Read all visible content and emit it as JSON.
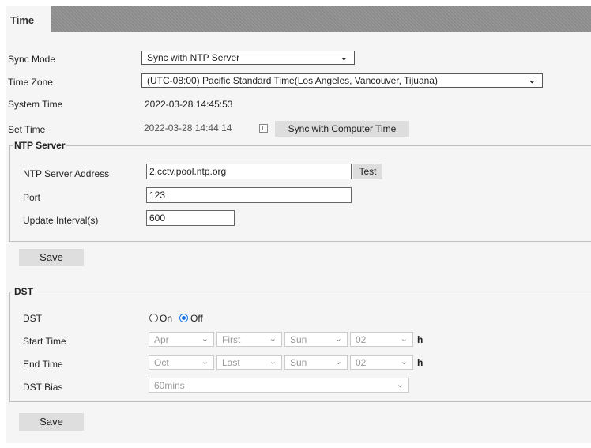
{
  "tabs": [
    {
      "label": "Time"
    }
  ],
  "time": {
    "sync_mode_label": "Sync Mode",
    "sync_mode_value": "Sync with NTP Server",
    "time_zone_label": "Time Zone",
    "time_zone_value": "(UTC-08:00) Pacific Standard Time(Los Angeles, Vancouver, Tijuana)",
    "system_time_label": "System Time",
    "system_time_value": "2022-03-28 14:45:53",
    "set_time_label": "Set Time",
    "set_time_value": "2022-03-28 14:44:14",
    "sync_computer_label": "Sync with Computer Time"
  },
  "ntp": {
    "legend": "NTP Server",
    "address_label": "NTP Server Address",
    "address_value": "2.cctv.pool.ntp.org",
    "test_label": "Test",
    "port_label": "Port",
    "port_value": "123",
    "interval_label": "Update Interval(s)",
    "interval_value": "600"
  },
  "save_label": "Save",
  "dst": {
    "legend": "DST",
    "dst_label": "DST",
    "on_label": "On",
    "off_label": "Off",
    "selected": "Off",
    "start_label": "Start Time",
    "start": {
      "month": "Apr",
      "week": "First",
      "day": "Sun",
      "hour": "02"
    },
    "end_label": "End Time",
    "end": {
      "month": "Oct",
      "week": "Last",
      "day": "Sun",
      "hour": "02"
    },
    "hour_unit": "h",
    "bias_label": "DST Bias",
    "bias_value": "60mins"
  },
  "icons": {
    "dropdown": "chevron-down-icon",
    "calendar": "calendar-icon"
  },
  "colors": {
    "tabbar": "#8c8c8c",
    "panel": "#f5f5f5",
    "radio_accent": "#1a73e8"
  }
}
